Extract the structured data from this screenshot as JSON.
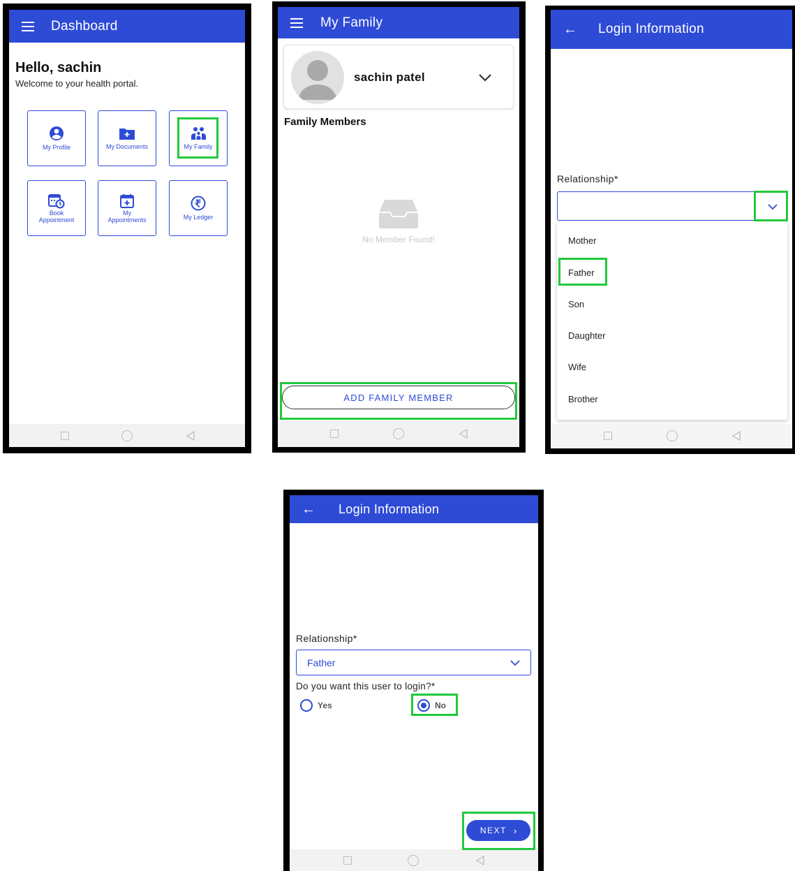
{
  "accent": "#2e4bd6",
  "highlight": "#22c93c",
  "dashboard": {
    "title": "Dashboard",
    "greeting": "Hello, sachin",
    "subtitle": "Welcome to your health portal.",
    "tiles": [
      {
        "label": "My Profile",
        "icon": "user-circle-icon"
      },
      {
        "label": "My Documents",
        "icon": "folder-plus-icon"
      },
      {
        "label": "My Family",
        "icon": "family-icon"
      },
      {
        "label": "Book Appointment",
        "icon": "calendar-clock-icon"
      },
      {
        "label": "My Appointments",
        "icon": "calendar-plus-icon"
      },
      {
        "label": "My Ledger",
        "icon": "rupee-icon"
      }
    ]
  },
  "family": {
    "title": "My Family",
    "user_name": "sachin patel",
    "section": "Family Members",
    "empty": "No Member Found!",
    "add_button": "ADD FAMILY MEMBER"
  },
  "login_dropdown": {
    "title": "Login Information",
    "field_label": "Relationship*",
    "options": [
      "Mother",
      "Father",
      "Son",
      "Daughter",
      "Wife",
      "Brother"
    ]
  },
  "login_form": {
    "title": "Login Information",
    "field_label": "Relationship*",
    "selected": "Father",
    "question": "Do you want this user to login?*",
    "yes": "Yes",
    "no": "No",
    "next": "NEXT"
  }
}
